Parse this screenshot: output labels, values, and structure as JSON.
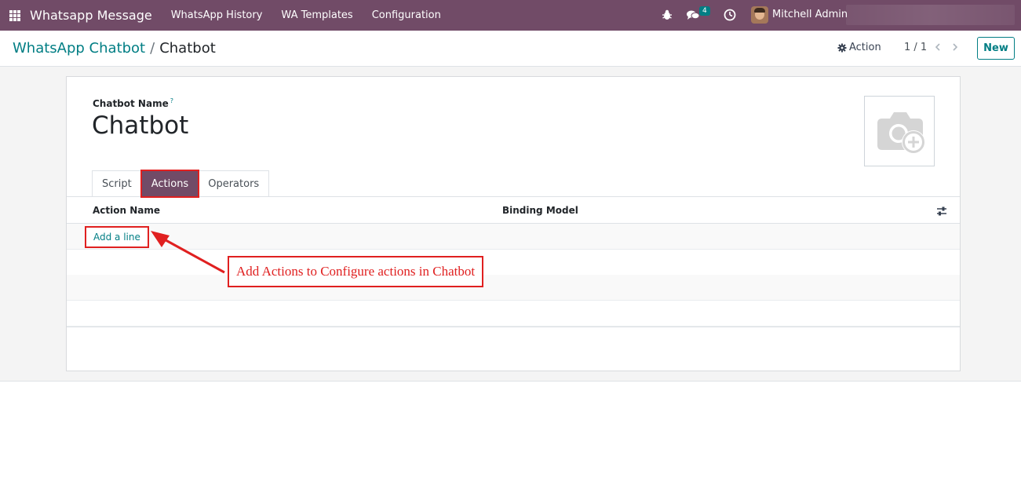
{
  "navbar": {
    "app_title": "Whatsapp Message",
    "menu": [
      "WhatsApp History",
      "WA Templates",
      "Configuration"
    ],
    "chat_count": "4",
    "user_name": "Mitchell Admin"
  },
  "control_panel": {
    "breadcrumb_parent": "WhatsApp Chatbot",
    "breadcrumb_separator": "/",
    "breadcrumb_current": "Chatbot",
    "action_label": "Action",
    "pager": "1 / 1",
    "new_label": "New"
  },
  "form": {
    "name_label": "Chatbot Name",
    "help_mark": "?",
    "name_value": "Chatbot",
    "tabs": [
      "Script",
      "Actions",
      "Operators"
    ],
    "active_tab": "Actions",
    "columns": [
      "Action Name",
      "Binding Model"
    ],
    "add_line_label": "Add a line"
  },
  "annotation": {
    "text": "Add Actions to Configure actions in Chatbot",
    "color": "#e02020"
  },
  "colors": {
    "navbar": "#714b67",
    "accent": "#017e84"
  }
}
